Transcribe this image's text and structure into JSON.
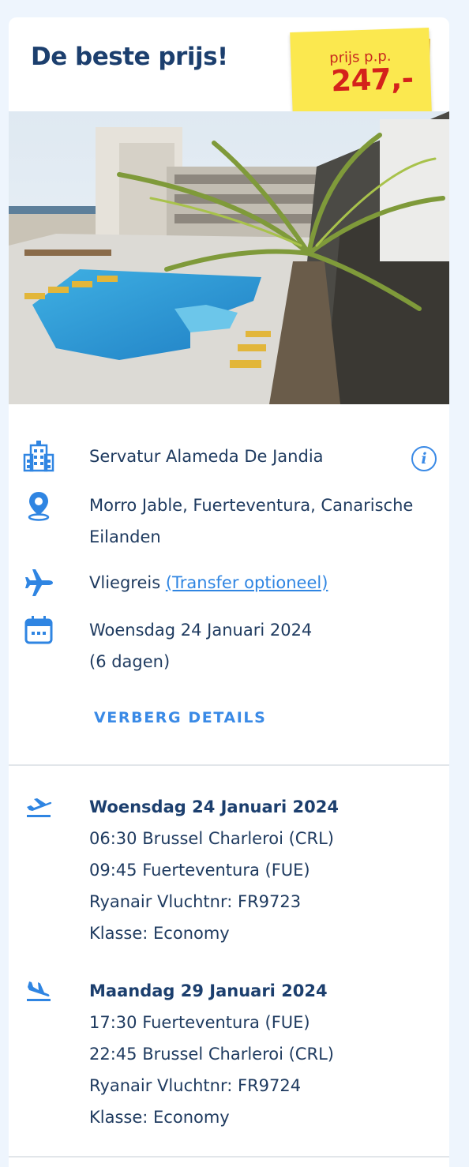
{
  "header": {
    "title": "De beste prijs!",
    "price_label": "prijs p.p.",
    "price_value": "247,-"
  },
  "hotel": {
    "name": "Servatur Alameda De Jandia",
    "location_line1": "Morro Jable, Fuerteventura, Canarische",
    "location_line2": "Eilanden",
    "travel_type": "Vliegreis",
    "transfer_link": "(Transfer optioneel)",
    "date_line1": "Woensdag 24 Januari 2024",
    "date_line2": "(6 dagen)"
  },
  "details_toggle_label": "VERBERG DETAILS",
  "flights": [
    {
      "direction": "outbound",
      "icon": "plane-departure-icon",
      "date": "Woensdag 24 Januari 2024",
      "departure": "06:30 Brussel Charleroi (CRL)",
      "arrival": "09:45 Fuerteventura (FUE)",
      "flight_number": "Ryanair Vluchtnr: FR9723",
      "class": "Klasse: Economy"
    },
    {
      "direction": "return",
      "icon": "plane-arrival-icon",
      "date": "Maandag 29 Januari 2024",
      "departure": "17:30 Fuerteventura (FUE)",
      "arrival": "22:45 Brussel Charleroi (CRL)",
      "flight_number": "Ryanair Vluchtnr: FR9724",
      "class": "Klasse: Economy"
    }
  ],
  "colors": {
    "page_background": "#eef5fd",
    "title": "#1c3f6e",
    "accent_blue": "#3a8ae6",
    "price_red": "#d4221b",
    "sticker_yellow": "#fbe84f"
  }
}
